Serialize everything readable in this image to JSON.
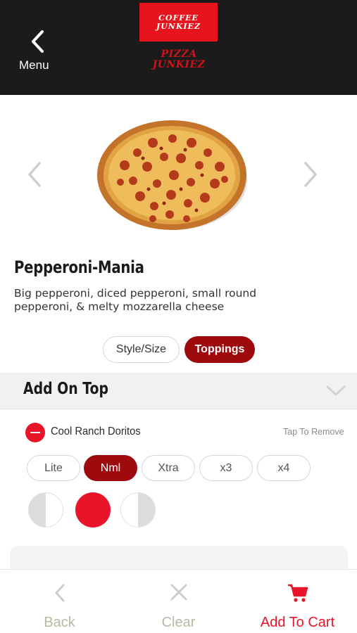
{
  "header": {
    "back_label": "Menu",
    "logo_top_lines": [
      "COFFEE",
      "JUNKIEZ"
    ],
    "logo_bottom_lines": [
      "PIZZA",
      "JUNKIEZ"
    ]
  },
  "product": {
    "name": "Pepperoni-Mania",
    "description": "Big pepperoni, diced pepperoni, small round pepperoni, & melty mozzarella cheese"
  },
  "tabs": [
    {
      "label": "Style/Size",
      "active": false
    },
    {
      "label": "Toppings",
      "active": true
    }
  ],
  "section": {
    "title": "Add On Top"
  },
  "topping": {
    "name": "Cool Ranch Doritos",
    "hint": "Tap To Remove",
    "amounts": [
      {
        "label": "Lite",
        "selected": false
      },
      {
        "label": "Nml",
        "selected": true
      },
      {
        "label": "Xtra",
        "selected": false
      },
      {
        "label": "x3",
        "selected": false
      },
      {
        "label": "x4",
        "selected": false
      }
    ],
    "placement_selected": "whole"
  },
  "bottom_bar": {
    "back_label": "Back",
    "clear_label": "Clear",
    "cart_label": "Add To Cart"
  },
  "colors": {
    "accent_red": "#e8142a",
    "dark_red": "#9e0b0f",
    "header_bg": "#1b1b1b",
    "muted_label": "#b8b8a4"
  },
  "icons": {
    "back": "chevron-left-icon",
    "prev": "chevron-left-icon",
    "next": "chevron-right-icon",
    "collapse": "chevron-down-icon",
    "clear": "close-icon",
    "cart": "cart-icon"
  }
}
